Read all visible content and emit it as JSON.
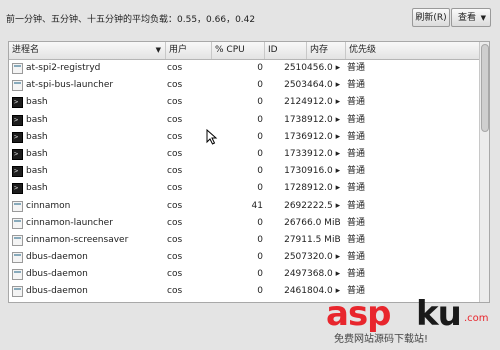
{
  "load_average": "前一分钟、五分钟、十五分钟的平均负载：0.55，0.66，0.42",
  "buttons": {
    "refresh": "刷新(R)",
    "view": "查看"
  },
  "columns": {
    "name": "进程名",
    "user": "用户",
    "cpu": "% CPU",
    "id": "ID",
    "memory": "内存",
    "priority": "优先级"
  },
  "processes": [
    {
      "icon": "generic",
      "name": "at-spi2-registryd",
      "user": "cos",
      "cpu": "0",
      "id": "2510",
      "memory": "456.0 ▸",
      "priority": "普通"
    },
    {
      "icon": "generic",
      "name": "at-spi-bus-launcher",
      "user": "cos",
      "cpu": "0",
      "id": "2503",
      "memory": "464.0 ▸",
      "priority": "普通"
    },
    {
      "icon": "terminal",
      "name": "bash",
      "user": "cos",
      "cpu": "0",
      "id": "2124",
      "memory": "912.0 ▸",
      "priority": "普通"
    },
    {
      "icon": "terminal",
      "name": "bash",
      "user": "cos",
      "cpu": "0",
      "id": "1738",
      "memory": "912.0 ▸",
      "priority": "普通"
    },
    {
      "icon": "terminal",
      "name": "bash",
      "user": "cos",
      "cpu": "0",
      "id": "1736",
      "memory": "912.0 ▸",
      "priority": "普通"
    },
    {
      "icon": "terminal",
      "name": "bash",
      "user": "cos",
      "cpu": "0",
      "id": "1733",
      "memory": "912.0 ▸",
      "priority": "普通"
    },
    {
      "icon": "terminal",
      "name": "bash",
      "user": "cos",
      "cpu": "0",
      "id": "1730",
      "memory": "916.0 ▸",
      "priority": "普通"
    },
    {
      "icon": "terminal",
      "name": "bash",
      "user": "cos",
      "cpu": "0",
      "id": "1728",
      "memory": "912.0 ▸",
      "priority": "普通"
    },
    {
      "icon": "generic",
      "name": "cinnamon",
      "user": "cos",
      "cpu": "41",
      "id": "2692",
      "memory": "222.5 ▸",
      "priority": "普通"
    },
    {
      "icon": "generic",
      "name": "cinnamon-launcher",
      "user": "cos",
      "cpu": "0",
      "id": "2676",
      "memory": "6.0 MiB",
      "priority": "普通"
    },
    {
      "icon": "generic",
      "name": "cinnamon-screensaver",
      "user": "cos",
      "cpu": "0",
      "id": "2791",
      "memory": "1.5 MiB",
      "priority": "普通"
    },
    {
      "icon": "generic",
      "name": "dbus-daemon",
      "user": "cos",
      "cpu": "0",
      "id": "2507",
      "memory": "320.0 ▸",
      "priority": "普通"
    },
    {
      "icon": "generic",
      "name": "dbus-daemon",
      "user": "cos",
      "cpu": "0",
      "id": "2497",
      "memory": "368.0 ▸",
      "priority": "普通"
    },
    {
      "icon": "generic",
      "name": "dbus-daemon",
      "user": "cos",
      "cpu": "0",
      "id": "2461",
      "memory": "804.0 ▸",
      "priority": "普通"
    }
  ],
  "watermark": {
    "part1": "asp",
    "part2": "ku",
    "part3": ".com",
    "subtitle": "免费网站源码下载站!"
  }
}
